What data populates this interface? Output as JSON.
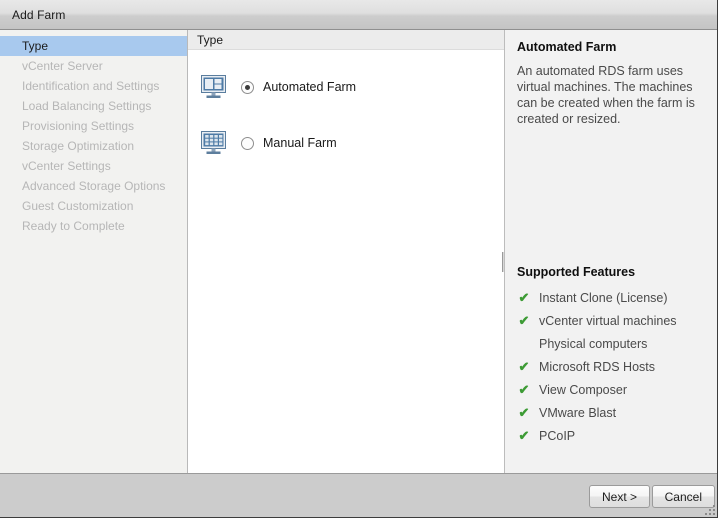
{
  "window": {
    "title": "Add Farm"
  },
  "sidebar": {
    "items": [
      {
        "label": "Type",
        "active": true
      },
      {
        "label": "vCenter Server",
        "active": false
      },
      {
        "label": "Identification and Settings",
        "active": false
      },
      {
        "label": "Load Balancing Settings",
        "active": false
      },
      {
        "label": "Provisioning Settings",
        "active": false
      },
      {
        "label": "Storage Optimization",
        "active": false
      },
      {
        "label": "vCenter Settings",
        "active": false
      },
      {
        "label": "Advanced Storage Options",
        "active": false
      },
      {
        "label": "Guest Customization",
        "active": false
      },
      {
        "label": "Ready to Complete",
        "active": false
      }
    ]
  },
  "main": {
    "header": "Type",
    "options": [
      {
        "label": "Automated Farm",
        "selected": true,
        "icon": "automated-farm-monitor-icon"
      },
      {
        "label": "Manual Farm",
        "selected": false,
        "icon": "manual-farm-monitor-icon"
      }
    ]
  },
  "info": {
    "title": "Automated Farm",
    "description": "An automated RDS farm uses virtual machines. The machines can be created when the farm is created or resized.",
    "features_title": "Supported Features",
    "features": [
      {
        "label": "Instant Clone (License)",
        "supported": true
      },
      {
        "label": "vCenter virtual machines",
        "supported": true
      },
      {
        "label": "Physical computers",
        "supported": false
      },
      {
        "label": "Microsoft RDS Hosts",
        "supported": true
      },
      {
        "label": "View Composer",
        "supported": true
      },
      {
        "label": "VMware Blast",
        "supported": true
      },
      {
        "label": "PCoIP",
        "supported": true
      }
    ]
  },
  "footer": {
    "next_label": "Next >",
    "cancel_label": "Cancel"
  },
  "colors": {
    "accent_selection": "#a8c9ee",
    "check_green": "#3d9b35",
    "icon_blue": "#41688f",
    "title_text": "#1a1a1a"
  },
  "icons": {
    "check": "✔"
  }
}
